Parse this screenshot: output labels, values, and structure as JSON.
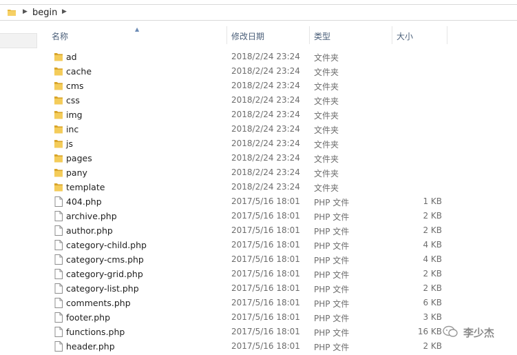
{
  "address": {
    "folder_icon": "folder-icon",
    "path": "begin"
  },
  "columns": {
    "name": "名称",
    "date": "修改日期",
    "type": "类型",
    "size": "大小"
  },
  "files": [
    {
      "name": "ad",
      "date": "2018/2/24 23:24",
      "type": "文件夹",
      "size": "",
      "icon": "folder-icon"
    },
    {
      "name": "cache",
      "date": "2018/2/24 23:24",
      "type": "文件夹",
      "size": "",
      "icon": "folder-icon"
    },
    {
      "name": "cms",
      "date": "2018/2/24 23:24",
      "type": "文件夹",
      "size": "",
      "icon": "folder-icon"
    },
    {
      "name": "css",
      "date": "2018/2/24 23:24",
      "type": "文件夹",
      "size": "",
      "icon": "folder-icon"
    },
    {
      "name": "img",
      "date": "2018/2/24 23:24",
      "type": "文件夹",
      "size": "",
      "icon": "folder-icon"
    },
    {
      "name": "inc",
      "date": "2018/2/24 23:24",
      "type": "文件夹",
      "size": "",
      "icon": "folder-icon"
    },
    {
      "name": "js",
      "date": "2018/2/24 23:24",
      "type": "文件夹",
      "size": "",
      "icon": "folder-icon"
    },
    {
      "name": "pages",
      "date": "2018/2/24 23:24",
      "type": "文件夹",
      "size": "",
      "icon": "folder-icon"
    },
    {
      "name": "pany",
      "date": "2018/2/24 23:24",
      "type": "文件夹",
      "size": "",
      "icon": "folder-icon"
    },
    {
      "name": "template",
      "date": "2018/2/24 23:24",
      "type": "文件夹",
      "size": "",
      "icon": "folder-icon"
    },
    {
      "name": "404.php",
      "date": "2017/5/16 18:01",
      "type": "PHP 文件",
      "size": "1 KB",
      "icon": "file-icon"
    },
    {
      "name": "archive.php",
      "date": "2017/5/16 18:01",
      "type": "PHP 文件",
      "size": "2 KB",
      "icon": "file-icon"
    },
    {
      "name": "author.php",
      "date": "2017/5/16 18:01",
      "type": "PHP 文件",
      "size": "2 KB",
      "icon": "file-icon"
    },
    {
      "name": "category-child.php",
      "date": "2017/5/16 18:01",
      "type": "PHP 文件",
      "size": "4 KB",
      "icon": "file-icon"
    },
    {
      "name": "category-cms.php",
      "date": "2017/5/16 18:01",
      "type": "PHP 文件",
      "size": "4 KB",
      "icon": "file-icon"
    },
    {
      "name": "category-grid.php",
      "date": "2017/5/16 18:01",
      "type": "PHP 文件",
      "size": "2 KB",
      "icon": "file-icon"
    },
    {
      "name": "category-list.php",
      "date": "2017/5/16 18:01",
      "type": "PHP 文件",
      "size": "2 KB",
      "icon": "file-icon"
    },
    {
      "name": "comments.php",
      "date": "2017/5/16 18:01",
      "type": "PHP 文件",
      "size": "6 KB",
      "icon": "file-icon"
    },
    {
      "name": "footer.php",
      "date": "2017/5/16 18:01",
      "type": "PHP 文件",
      "size": "3 KB",
      "icon": "file-icon"
    },
    {
      "name": "functions.php",
      "date": "2017/5/16 18:01",
      "type": "PHP 文件",
      "size": "16 KB",
      "icon": "file-icon"
    },
    {
      "name": "header.php",
      "date": "2017/5/16 18:01",
      "type": "PHP 文件",
      "size": "2 KB",
      "icon": "file-icon"
    }
  ],
  "watermark": {
    "text": "李少杰",
    "icon": "wechat-icon"
  },
  "colors": {
    "folder": "#e8b83a",
    "header_text": "#4c607a",
    "meta_text": "#6d6d6d"
  }
}
